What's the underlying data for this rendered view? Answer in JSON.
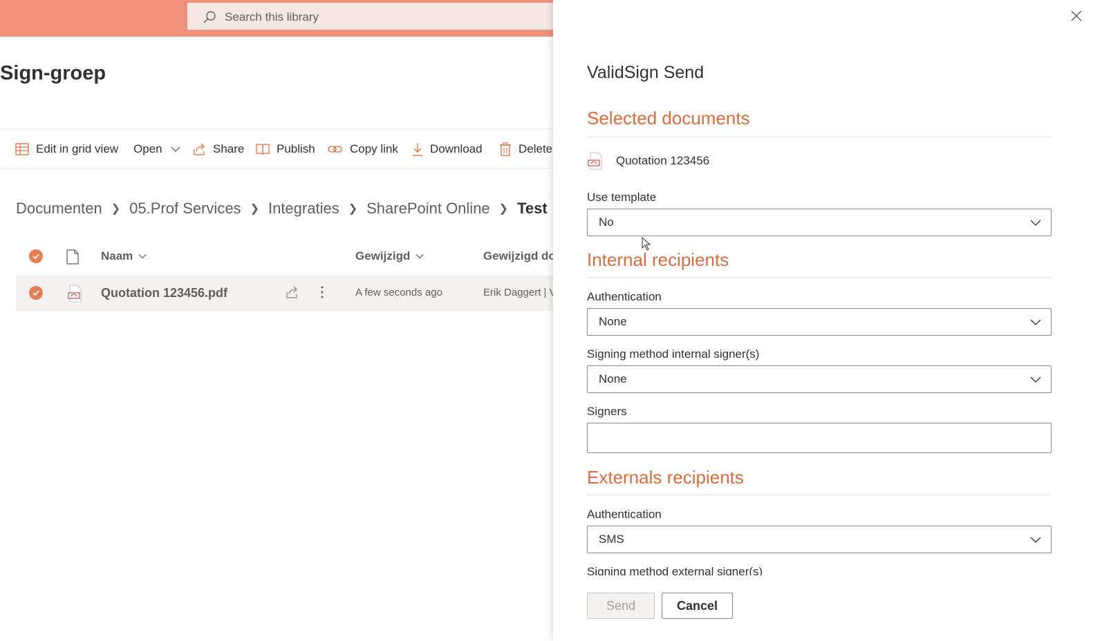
{
  "search": {
    "placeholder": "Search this library"
  },
  "site": {
    "title": "lSign-groep"
  },
  "commands": [
    {
      "label": "Edit in grid view",
      "icon": "grid-icon"
    },
    {
      "label": "Open",
      "icon": "chevron-down-icon"
    },
    {
      "label": "Share",
      "icon": "share-icon"
    },
    {
      "label": "Publish",
      "icon": "publish-icon"
    },
    {
      "label": "Copy link",
      "icon": "link-icon"
    },
    {
      "label": "Download",
      "icon": "download-icon"
    },
    {
      "label": "Delete",
      "icon": "trash-icon"
    }
  ],
  "breadcrumb": [
    "Documenten",
    "05.Prof Services",
    "Integraties",
    "SharePoint Online",
    "Test"
  ],
  "columns": {
    "name": "Naam",
    "modified": "Gewijzigd",
    "modified_by": "Gewijzigd do"
  },
  "files": [
    {
      "name": "Quotation 123456.pdf",
      "modified": "A few seconds ago",
      "modified_by": "Erik Daggert | V"
    }
  ],
  "panel": {
    "title": "ValidSign Send",
    "selected_documents_heading": "Selected documents",
    "selected_document": "Quotation 123456",
    "use_template_label": "Use template",
    "use_template_value": "No",
    "internal_heading": "Internal recipients",
    "internal_auth_label": "Authentication",
    "internal_auth_value": "None",
    "internal_signing_label": "Signing method internal signer(s)",
    "internal_signing_value": "None",
    "signers_label": "Signers",
    "signers_value": "",
    "external_heading": "Externals recipients",
    "external_auth_label": "Authentication",
    "external_auth_value": "SMS",
    "external_signing_label": "Signing method external signer(s)",
    "send_label": "Send",
    "cancel_label": "Cancel"
  },
  "colors": {
    "suite_bar": "#f0917c",
    "accent": "#e06b3a",
    "check": "#e67e52"
  }
}
